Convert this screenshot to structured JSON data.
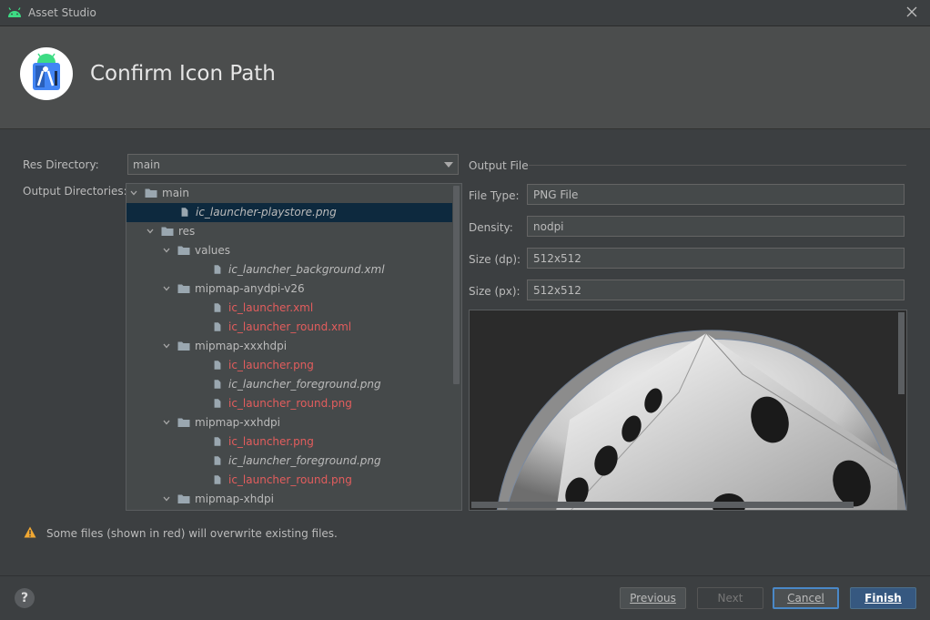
{
  "window": {
    "title": "Asset Studio"
  },
  "header": {
    "title": "Confirm Icon Path"
  },
  "res_directory": {
    "label": "Res Directory:",
    "value": "main"
  },
  "output_directories": {
    "label": "Output Directories:",
    "tree": [
      {
        "text": "main",
        "type": "folder",
        "depth": 0,
        "expanded": true,
        "style": "normal"
      },
      {
        "text": "ic_launcher-playstore.png",
        "type": "file",
        "depth": 1,
        "style": "italic",
        "selected": true
      },
      {
        "text": "res",
        "type": "folder",
        "depth": 1,
        "expanded": true,
        "style": "normal"
      },
      {
        "text": "values",
        "type": "folder",
        "depth": 2,
        "expanded": true,
        "style": "normal"
      },
      {
        "text": "ic_launcher_background.xml",
        "type": "file",
        "depth": 3,
        "style": "italic"
      },
      {
        "text": "mipmap-anydpi-v26",
        "type": "folder",
        "depth": 2,
        "expanded": true,
        "style": "normal"
      },
      {
        "text": "ic_launcher.xml",
        "type": "file",
        "depth": 3,
        "style": "red"
      },
      {
        "text": "ic_launcher_round.xml",
        "type": "file",
        "depth": 3,
        "style": "red"
      },
      {
        "text": "mipmap-xxxhdpi",
        "type": "folder",
        "depth": 2,
        "expanded": true,
        "style": "normal"
      },
      {
        "text": "ic_launcher.png",
        "type": "file",
        "depth": 3,
        "style": "red"
      },
      {
        "text": "ic_launcher_foreground.png",
        "type": "file",
        "depth": 3,
        "style": "italic"
      },
      {
        "text": "ic_launcher_round.png",
        "type": "file",
        "depth": 3,
        "style": "red"
      },
      {
        "text": "mipmap-xxhdpi",
        "type": "folder",
        "depth": 2,
        "expanded": true,
        "style": "normal"
      },
      {
        "text": "ic_launcher.png",
        "type": "file",
        "depth": 3,
        "style": "red"
      },
      {
        "text": "ic_launcher_foreground.png",
        "type": "file",
        "depth": 3,
        "style": "italic"
      },
      {
        "text": "ic_launcher_round.png",
        "type": "file",
        "depth": 3,
        "style": "red"
      },
      {
        "text": "mipmap-xhdpi",
        "type": "folder",
        "depth": 2,
        "expanded": true,
        "style": "normal"
      }
    ]
  },
  "output_file": {
    "section_title": "Output File",
    "file_type": {
      "label": "File Type:",
      "value": "PNG File"
    },
    "density": {
      "label": "Density:",
      "value": "nodpi"
    },
    "size_dp": {
      "label": "Size (dp):",
      "value": "512x512"
    },
    "size_px": {
      "label": "Size (px):",
      "value": "512x512"
    }
  },
  "warning": {
    "text": "Some files (shown in red) will overwrite existing files."
  },
  "buttons": {
    "help": "?",
    "previous": "Previous",
    "next": "Next",
    "cancel": "Cancel",
    "finish": "Finish"
  },
  "colors": {
    "overwrite_text": "#e35d5d",
    "selection": "#0d293e",
    "primary_button": "#365880",
    "focus_ring": "#4a88c7"
  }
}
